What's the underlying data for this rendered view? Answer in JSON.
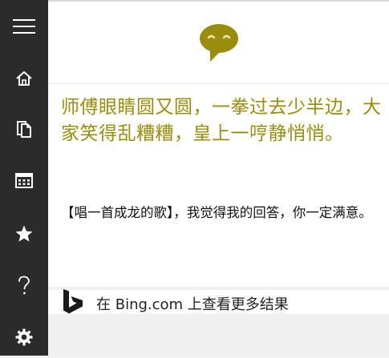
{
  "sidebar": {
    "items": [
      {
        "name": "menu",
        "icon": "hamburger-icon"
      },
      {
        "name": "home",
        "icon": "home-icon"
      },
      {
        "name": "notebook",
        "icon": "notebook-icon"
      },
      {
        "name": "reminders",
        "icon": "calendar-icon"
      },
      {
        "name": "favorites",
        "icon": "star-icon"
      },
      {
        "name": "help",
        "icon": "question-icon"
      },
      {
        "name": "settings",
        "icon": "gear-icon"
      }
    ]
  },
  "cortana": {
    "avatar_icon": "cortana-speech-bubble-icon",
    "accent_color": "#9a8c0c"
  },
  "response": {
    "headline": "师傅眼睛圆又圆，一拳过去少半边，大家笑得乱糟糟，皇上一哼静悄悄。",
    "body": "【唱一首成龙的歌】，我觉得我的回答，你一定满意。"
  },
  "bing": {
    "icon": "bing-logo-icon",
    "label": "在 Bing.com 上查看更多结果"
  }
}
